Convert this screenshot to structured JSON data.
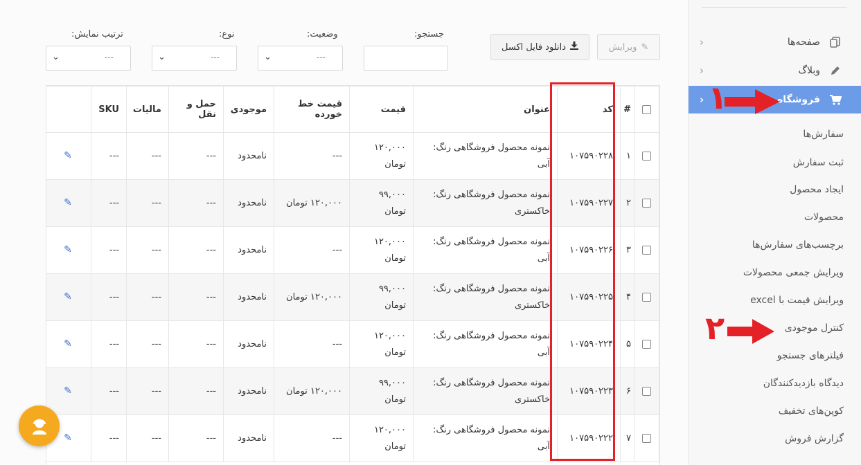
{
  "sidebar": {
    "menu": [
      {
        "label": "صفحه‌ها",
        "icon": "pages-icon",
        "active": false
      },
      {
        "label": "وبلاگ",
        "icon": "pencil-icon",
        "active": false
      },
      {
        "label": "فروشگاه",
        "icon": "cart-icon",
        "active": true
      }
    ],
    "submenu": [
      "سفارش‌ها",
      "ثبت سفارش",
      "ایجاد محصول",
      "محصولات",
      "برچسب‌های سفارش‌ها",
      "ویرایش جمعی محصولات",
      "ویرایش قیمت با excel",
      "کنترل موجودی",
      "فیلترهای جستجو",
      "دیدگاه بازدیدکنندگان",
      "کوپن‌های تخفیف",
      "گزارش فروش"
    ]
  },
  "annotations": {
    "one": "۱",
    "two": "۲",
    "color": "#e32127"
  },
  "filters": {
    "search_label": "جستجو:",
    "status_label": "وضعیت:",
    "type_label": "نوع:",
    "sort_label": "ترتیب نمایش:",
    "select_value": "---"
  },
  "toolbar": {
    "edit_label": "ویرایش",
    "download_label": "دانلود فایل اکسل"
  },
  "table": {
    "headers": {
      "num": "#",
      "code": "کد",
      "title": "عنوان",
      "price": "قیمت",
      "strike_price": "قیمت خط خورده",
      "stock": "موجودی",
      "shipping": "حمل و نقل",
      "tax": "مالیات",
      "sku": "SKU"
    },
    "rows": [
      {
        "num": "۱",
        "code": "۱۰۷۵۹۰۲۲۸",
        "title": "نمونه محصول فروشگاهی رنگ: آبی",
        "price": "۱۲۰,۰۰۰ تومان",
        "strike_price": "---",
        "stock": "نامحدود",
        "shipping": "---",
        "tax": "---",
        "sku": "---"
      },
      {
        "num": "۲",
        "code": "۱۰۷۵۹۰۲۲۷",
        "title": "نمونه محصول فروشگاهی رنگ: خاکستری",
        "price": "۹۹,۰۰۰ تومان",
        "strike_price": "۱۲۰,۰۰۰ تومان",
        "stock": "نامحدود",
        "shipping": "---",
        "tax": "---",
        "sku": "---"
      },
      {
        "num": "۳",
        "code": "۱۰۷۵۹۰۲۲۶",
        "title": "نمونه محصول فروشگاهی رنگ: آبی",
        "price": "۱۲۰,۰۰۰ تومان",
        "strike_price": "---",
        "stock": "نامحدود",
        "shipping": "---",
        "tax": "---",
        "sku": "---"
      },
      {
        "num": "۴",
        "code": "۱۰۷۵۹۰۲۲۵",
        "title": "نمونه محصول فروشگاهی رنگ: خاکستری",
        "price": "۹۹,۰۰۰ تومان",
        "strike_price": "۱۲۰,۰۰۰ تومان",
        "stock": "نامحدود",
        "shipping": "---",
        "tax": "---",
        "sku": "---"
      },
      {
        "num": "۵",
        "code": "۱۰۷۵۹۰۲۲۴",
        "title": "نمونه محصول فروشگاهی رنگ: آبی",
        "price": "۱۲۰,۰۰۰ تومان",
        "strike_price": "---",
        "stock": "نامحدود",
        "shipping": "---",
        "tax": "---",
        "sku": "---"
      },
      {
        "num": "۶",
        "code": "۱۰۷۵۹۰۲۲۳",
        "title": "نمونه محصول فروشگاهی رنگ: خاکستری",
        "price": "۹۹,۰۰۰ تومان",
        "strike_price": "۱۲۰,۰۰۰ تومان",
        "stock": "نامحدود",
        "shipping": "---",
        "tax": "---",
        "sku": "---"
      },
      {
        "num": "۷",
        "code": "۱۰۷۵۹۰۲۲۲",
        "title": "نمونه محصول فروشگاهی رنگ: آبی",
        "price": "۱۲۰,۰۰۰ تومان",
        "strike_price": "---",
        "stock": "نامحدود",
        "shipping": "---",
        "tax": "---",
        "sku": "---"
      }
    ]
  },
  "colors": {
    "accent": "#6c9be8",
    "fab": "#f4a91e",
    "annotation": "#e32127"
  }
}
